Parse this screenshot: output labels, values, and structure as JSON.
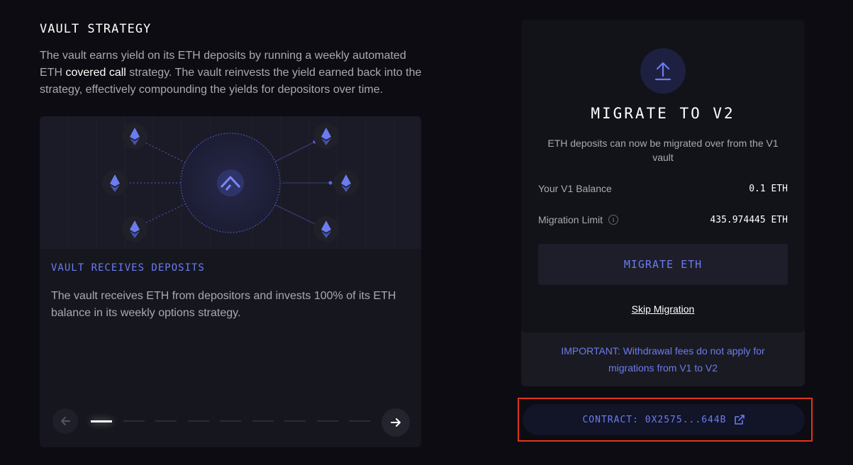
{
  "strategy": {
    "title": "VAULT STRATEGY",
    "desc_part1": "The vault earns yield on its ETH deposits by running a weekly automated ETH ",
    "desc_link": "covered call",
    "desc_part2": " strategy. The vault reinvests the yield earned back into the strategy, effectively compounding the yields for depositors over time."
  },
  "card": {
    "title": "VAULT RECEIVES DEPOSITS",
    "text": "The vault receives ETH from depositors and invests 100% of its ETH balance in its weekly options strategy.",
    "step_count": 9,
    "active_step": 1
  },
  "migration": {
    "title": "MIGRATE TO V2",
    "subtitle": "ETH deposits can now be migrated over from the V1 vault",
    "balance_label": "Your V1 Balance",
    "balance_value": "0.1 ETH",
    "limit_label": "Migration Limit",
    "limit_value": "435.974445 ETH",
    "button_label": "MIGRATE ETH",
    "skip_label": "Skip Migration",
    "important": "IMPORTANT: Withdrawal fees do not apply for migrations from V1 to V2"
  },
  "contract": {
    "label": "CONTRACT: 0X2575...644B"
  },
  "colors": {
    "accent": "#6b7cf0",
    "highlight": "#e2331a"
  },
  "icons": [
    "eth-icon",
    "ribbon-logo-icon",
    "arrow-left-icon",
    "arrow-right-icon",
    "upload-icon",
    "info-icon",
    "external-link-icon"
  ]
}
